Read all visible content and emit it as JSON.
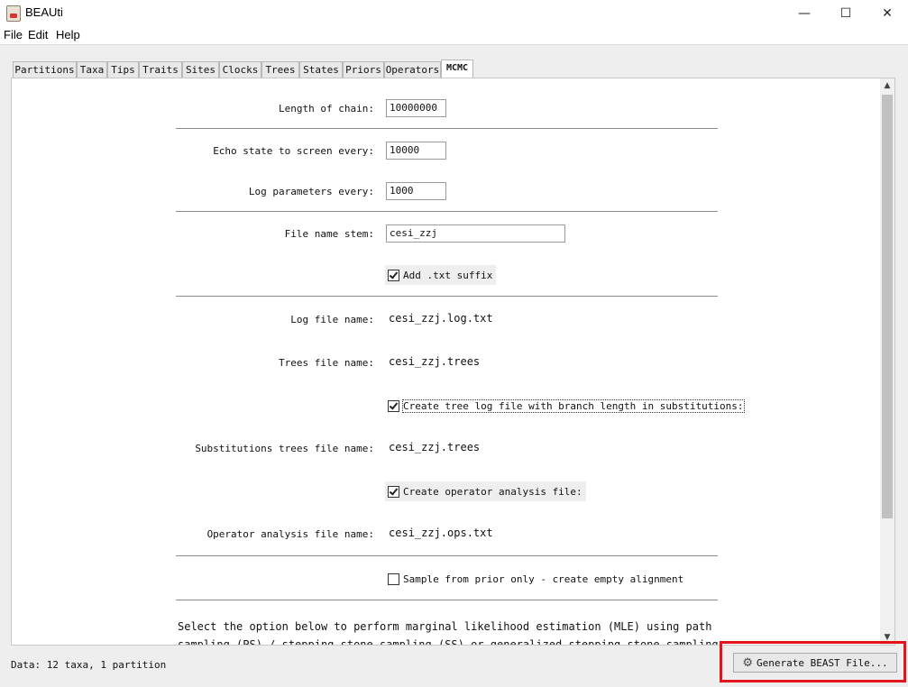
{
  "window": {
    "title": "BEAUti",
    "minimize": "—",
    "maximize": "☐",
    "close": "✕"
  },
  "menu": [
    "File",
    "Edit",
    "Help"
  ],
  "tabs": [
    "Partitions",
    "Taxa",
    "Tips",
    "Traits",
    "Sites",
    "Clocks",
    "Trees",
    "States",
    "Priors",
    "Operators",
    "MCMC"
  ],
  "active_tab": "MCMC",
  "mcmc": {
    "length_label": "Length of chain:",
    "length_value": "10000000",
    "echo_label": "Echo state to screen every:",
    "echo_value": "10000",
    "log_label": "Log parameters every:",
    "log_value": "1000",
    "stem_label": "File name stem:",
    "stem_value": "cesi_zzj",
    "add_txt_label": "Add .txt suffix",
    "add_txt_checked": true,
    "log_file_label": "Log file name:",
    "log_file_value": "cesi_zzj.log.txt",
    "trees_file_label": "Trees file name:",
    "trees_file_value": "cesi_zzj.trees",
    "tree_log_label": "Create tree log file with branch length in substitutions:",
    "tree_log_checked": true,
    "subst_label": "Substitutions trees file name:",
    "subst_value": "cesi_zzj.trees",
    "op_analysis_label": "Create operator analysis file:",
    "op_analysis_checked": true,
    "op_file_label": "Operator analysis file name:",
    "op_file_value": "cesi_zzj.ops.txt",
    "prior_only_label": "Sample from prior only - create empty alignment",
    "prior_only_checked": false,
    "mle_text": "Select the option below to perform marginal likelihood estimation (MLE) using path sampling (PS) / stepping-stone sampling (SS) or generalized stepping-stone sampling"
  },
  "status_text": "Data: 12 taxa, 1 partition",
  "generate_button": "Generate BEAST File...",
  "icons": {
    "gear": "gear-icon",
    "scroll_up": "▲",
    "scroll_down": "▼"
  },
  "colors": {
    "highlight": "#e4141c"
  }
}
